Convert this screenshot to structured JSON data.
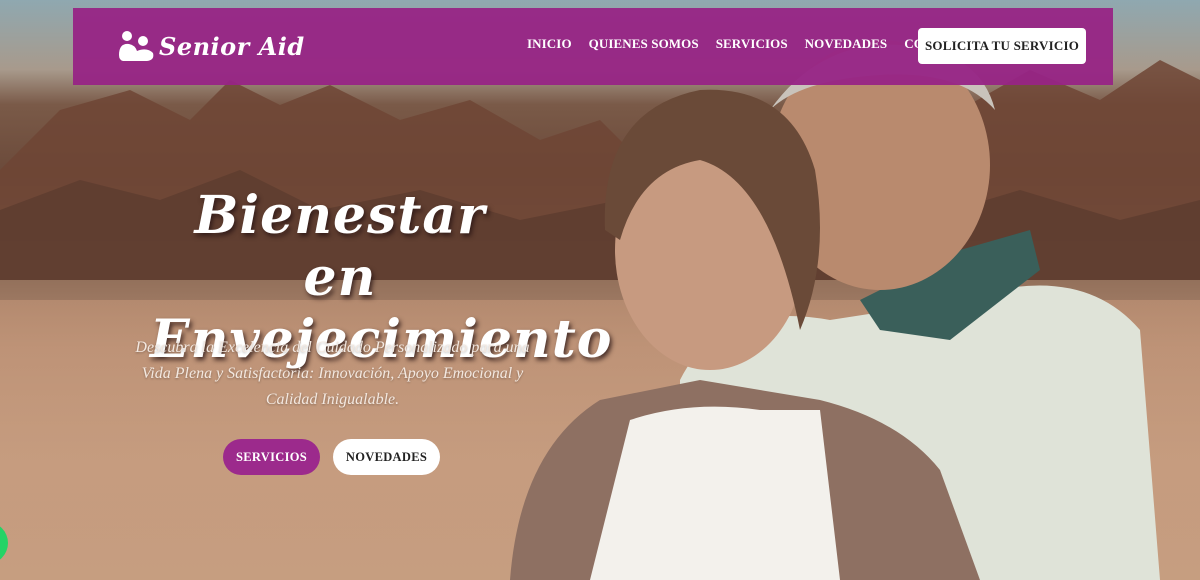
{
  "brand": {
    "name": "Senior Aid",
    "color": "#9c2a8c"
  },
  "nav": {
    "items": [
      "INICIO",
      "QUIENES SOMOS",
      "SERVICIOS",
      "NOVEDADES",
      "CONTACTO"
    ],
    "cta": "SOLICITA TU SERVICIO"
  },
  "hero": {
    "title_line1": "Bienestar en",
    "title_line2": "Envejecimiento",
    "subtitle": "Descubra la Excelencia del Cuidado Personalizado para una Vida Plena y Satisfactoria: Innovación, Apoyo Emocional y Calidad Inigualable.",
    "btn_services": "SERVICIOS",
    "btn_news": "NOVEDADES"
  },
  "icons": {
    "logo": "people-care-icon",
    "chat": "whatsapp-icon"
  },
  "colors": {
    "nav_bg": "#972485",
    "whatsapp": "#25d366"
  }
}
